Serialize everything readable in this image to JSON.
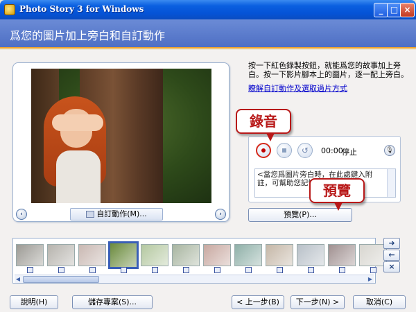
{
  "window": {
    "title": "Photo Story 3 for Windows",
    "min_glyph": "_",
    "max_glyph": "□",
    "close_glyph": "×"
  },
  "header": {
    "title": "爲您的圖片加上旁白和自訂動作"
  },
  "instructions": {
    "text": "按一下紅色錄製按鈕，就能爲您的故事加上旁白。按一下影片腳本上的圖片，逐一配上旁白。",
    "link": "瞭解自訂動作及選取過片方式"
  },
  "preview_panel": {
    "custom_motion_label": "自訂動作(M)...",
    "prev_glyph": "‹",
    "next_glyph": "›"
  },
  "recorder": {
    "time": "00:00",
    "status": "停止",
    "undo_glyph": "↺",
    "mic_glyph": "🎙",
    "narration_text": "<當您爲圖片旁白時，在此處鍵入附註，可幫助您記憶。>"
  },
  "preview_button": "預覽(P)...",
  "callouts": {
    "record": "錄音",
    "preview": "預覽"
  },
  "filmstrip": {
    "thumbnail_colors": [
      "#9c9a94",
      "#b6b3ad",
      "#c9b8b2",
      "#6a8a3c",
      "#b4c8a0",
      "#a8b5a0",
      "#c8a8a0",
      "#8fb0a8",
      "#c5b7a7",
      "#b8c0c8",
      "#a09090",
      "#d8d6d0"
    ],
    "selected_index": 3
  },
  "side_buttons": {
    "right": "➜",
    "left": "←",
    "remove": "×"
  },
  "buttons": {
    "help": "說明(H)",
    "save_project": "儲存專案(S)...",
    "back": "< 上一步(B)",
    "next": "下一步(N) >",
    "cancel": "取消(C)"
  }
}
